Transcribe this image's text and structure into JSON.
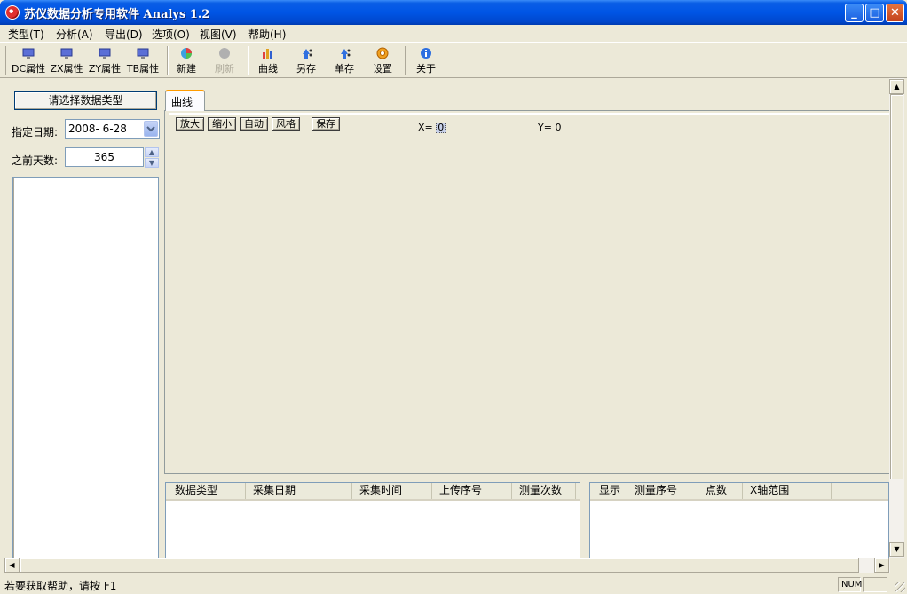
{
  "window": {
    "title": "苏仪数据分析专用软件 Analys 1.2",
    "minimize_glyph": "_",
    "maximize_glyph": "□",
    "close_glyph": "✕"
  },
  "menu": [
    {
      "label": "类型(T)"
    },
    {
      "label": "分析(A)"
    },
    {
      "label": "导出(D)"
    },
    {
      "label": "选项(O)"
    },
    {
      "label": "视图(V)"
    },
    {
      "label": "帮助(H)"
    }
  ],
  "toolbar": {
    "dc": "DC属性",
    "zx": "ZX属性",
    "zy": "ZY属性",
    "tb": "TB属性",
    "new": "新建",
    "refresh": "刷新",
    "curve": "曲线",
    "save_as": "另存",
    "single_save": "单存",
    "settings": "设置",
    "about": "关于"
  },
  "left_panel": {
    "select_type_button": "请选择数据类型",
    "date_label": "指定日期:",
    "date_value": "2008- 6-28",
    "days_label": "之前天数:",
    "days_value": "365"
  },
  "chart_tab": {
    "tab_label": "曲线",
    "zoom_in": "放大",
    "zoom_out": "缩小",
    "auto": "自动",
    "style": "风格",
    "save": "保存",
    "x_label": "X=",
    "x_value": "0",
    "y_label": "Y=",
    "y_value": "0"
  },
  "data_list": {
    "columns": [
      "数据类型",
      "采集日期",
      "采集时间",
      "上传序号",
      "测量次数"
    ]
  },
  "series_list": {
    "columns": [
      "显示",
      "测量序号",
      "点数",
      "X轴范围"
    ]
  },
  "status": {
    "help_text": "若要获取帮助，请按 F1",
    "num": "NUM"
  }
}
